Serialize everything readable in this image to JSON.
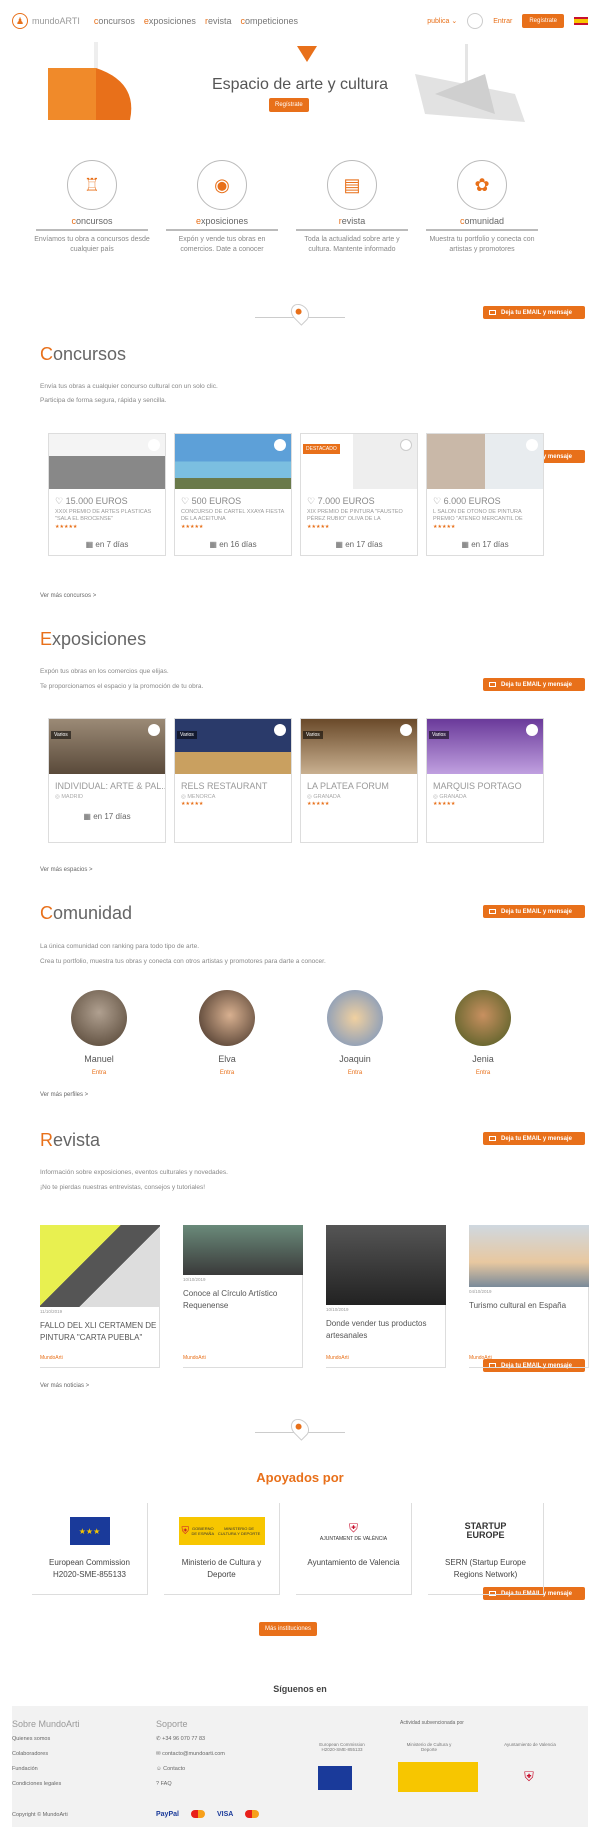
{
  "header": {
    "logo_text": "mundoARTI",
    "nav": [
      "concursos",
      "exposiciones",
      "revista",
      "competiciones"
    ],
    "lang_select": "publica",
    "login": "Entrar",
    "register": "Regístrate"
  },
  "hero": {
    "title": "Espacio de arte y cultura",
    "button": "Regístrate"
  },
  "features": [
    {
      "name": "concursos",
      "desc": "Envíamos tu obra a concursos desde cualquier país"
    },
    {
      "name": "exposiciones",
      "desc": "Expón y vende tus obras en comercios. Date a conocer"
    },
    {
      "name": "revista",
      "desc": "Toda la actualidad sobre arte y cultura. Mantente informado"
    },
    {
      "name": "comunidad",
      "desc": "Muestra tu portfolio y conecta con artistas y promotores"
    }
  ],
  "email_button": "Deja tu EMAIL y mensaje",
  "concursos": {
    "title": "Concursos",
    "desc": [
      "Envía tus obras a cualquier concurso cultural con un solo clic.",
      "Participa de forma segura, rápida y sencilla."
    ],
    "more": "Ver más concursos >",
    "cards": [
      {
        "price": "15.000 EUROS",
        "desc": "XXIX PREMIO DE ARTES PLÁSTICAS \"SALA EL BROCENSE\"",
        "days": "en 7 días",
        "tag": ""
      },
      {
        "price": "500 EUROS",
        "desc": "CONCURSO DE CARTEL XXAYA FIESTA DE LA ACEITUNA",
        "days": "en 16 días",
        "tag": ""
      },
      {
        "price": "7.000 EUROS",
        "desc": "XIX PREMIO DE PINTURA \"FAUSTEO PÉREZ RUBIO\" OLIVA DE LA FRONTERA...",
        "days": "en 17 días",
        "tag": "DESTACADO"
      },
      {
        "price": "6.000 EUROS",
        "desc": "L SALÓN DE OTOÑO DE PINTURA PREMIO \"ATENEO MERCANTIL DE VAL...",
        "days": "en 17 días",
        "tag": ""
      }
    ]
  },
  "exposiciones": {
    "title": "Exposiciones",
    "desc": [
      "Expón tus obras en los comercios que elijas.",
      "Te proporcionamos el espacio y la promoción de tu obra."
    ],
    "more": "Ver más espacios >",
    "cards": [
      {
        "type": "Varios",
        "name": "INDIVIDUAL: ARTE & PAL...",
        "loc": "MADRID",
        "days": "en 17 días"
      },
      {
        "type": "Varios",
        "name": "RELS RESTAURANT",
        "loc": "MENORCA",
        "days": ""
      },
      {
        "type": "Varios",
        "name": "LA PLATEA FORUM",
        "loc": "GRANADA",
        "days": ""
      },
      {
        "type": "Varios",
        "name": "MARQUIS PORTAGO",
        "loc": "GRANADA",
        "days": ""
      }
    ]
  },
  "comunidad": {
    "title": "Comunidad",
    "desc": [
      "La única comunidad con ranking para todo tipo de arte.",
      "Crea tu portfolio, muestra tus obras y conecta con otros artistas y promotores para darte a conocer."
    ],
    "more": "Ver más perfiles >",
    "people": [
      {
        "name": "Manuel",
        "enter": "Entra"
      },
      {
        "name": "Elva",
        "enter": "Entra"
      },
      {
        "name": "Joaquin",
        "enter": "Entra"
      },
      {
        "name": "Jenia",
        "enter": "Entra"
      }
    ]
  },
  "revista": {
    "title": "Revista",
    "desc": [
      "Información sobre exposiciones, eventos culturales y novedades.",
      "¡No te pierdas nuestras entrevistas, consejos y tutoriales!"
    ],
    "more": "Ver más noticias >",
    "articles": [
      {
        "date": "11/10/2019",
        "title": "FALLO DEL XLI CERTAMEN DE PINTURA \"CARTA PUEBLA\"",
        "author": "MundoArti"
      },
      {
        "date": "10/10/2019",
        "title": "Conoce al Círculo Artístico Requenense",
        "author": "MundoArti"
      },
      {
        "date": "10/10/2019",
        "title": "Donde vender tus productos artesanales",
        "author": "MundoArti"
      },
      {
        "date": "04/10/2019",
        "title": "Turismo cultural en España",
        "author": "MundoArti"
      }
    ]
  },
  "apoyados": {
    "title": "Apoyados por",
    "items": [
      {
        "name": "European Commission H2020-SME-855133"
      },
      {
        "name": "Ministerio de Cultura y Deporte"
      },
      {
        "name": "Ayuntamiento de Valencia"
      },
      {
        "name": "SERN (Startup Europe Regions Network)"
      }
    ],
    "button": "Más instituciones",
    "logo_labels": {
      "gobierno": "GOBIERNO DE ESPAÑA",
      "ministerio": "MINISTERIO DE CULTURA Y DEPORTE",
      "ayto": "AJUNTAMENT DE VALÈNCIA",
      "startup1": "STARTUP",
      "startup2": "EUROPE"
    }
  },
  "siguenos": "Síguenos en",
  "footer": {
    "col1_title": "Sobre MundoArti",
    "col1": [
      "Quienes somos",
      "Colaboradores",
      "Fundación",
      "Condiciones legales"
    ],
    "col2_title": "Soporte",
    "col2": [
      "+34 96 070 77 83",
      "contacto@mundoarti.com",
      "Contacto",
      "FAQ"
    ],
    "subv_title": "Actividad subvencionada por",
    "subv": [
      "European Commission H2020-SME-855133",
      "Ministerio de Cultura y Deporte",
      "Ayuntamiento de Valencia"
    ],
    "copyright": "Copyright © MundoArti",
    "payments": [
      "PayPal",
      "VISA"
    ]
  }
}
